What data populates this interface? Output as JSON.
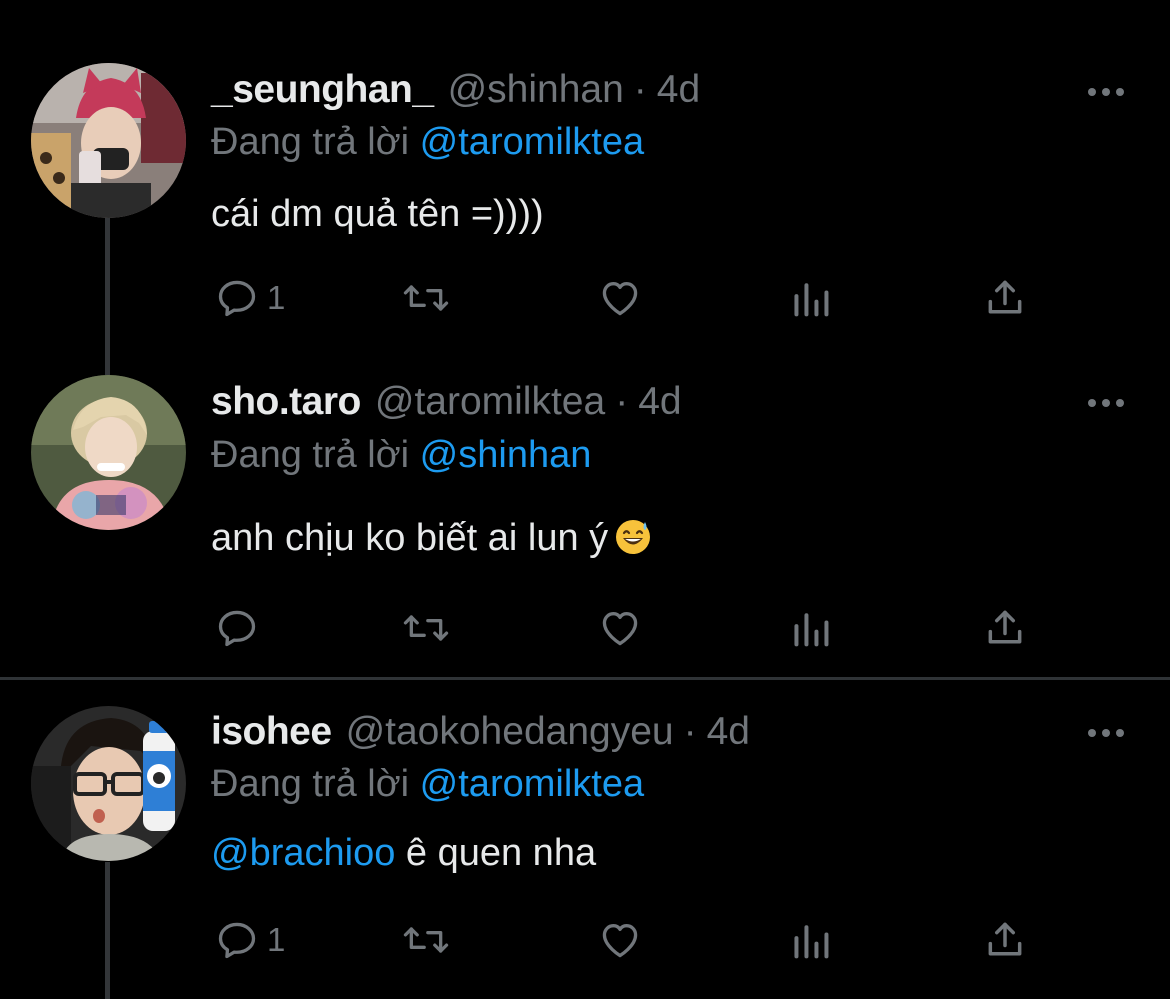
{
  "colors": {
    "background": "#000000",
    "primary_text": "#e7e9ea",
    "secondary_text": "#71767b",
    "accent": "#1d9bf0",
    "divider": "#2f3336"
  },
  "icons": {
    "reply": "reply-icon",
    "retweet": "retweet-icon",
    "like": "heart-icon",
    "views": "views-icon",
    "share": "share-icon",
    "more": "more-icon"
  },
  "tweets": [
    {
      "display_name": "_seunghan_",
      "handle": "@shinhan",
      "dot": "·",
      "time": "4d",
      "replying_prefix": "Đang trả lời",
      "replying_to": "@taromilktea",
      "text": "cái dm quả tên =))))",
      "reply_count": "1"
    },
    {
      "display_name": "sho.taro",
      "handle": "@taromilktea",
      "dot": "·",
      "time": "4d",
      "replying_prefix": "Đang trả lời",
      "replying_to": "@shinhan",
      "text": "anh chịu ko biết ai lun ý",
      "emoji": "grinning-face-with-sweat",
      "reply_count": ""
    },
    {
      "display_name": "isohee",
      "handle": "@taokohedangyeu",
      "dot": "·",
      "time": "4d",
      "replying_prefix": "Đang trả lời",
      "replying_to": "@taromilktea",
      "text_mention": "@brachioo",
      "text": " ê quen nha",
      "reply_count": "1"
    }
  ]
}
